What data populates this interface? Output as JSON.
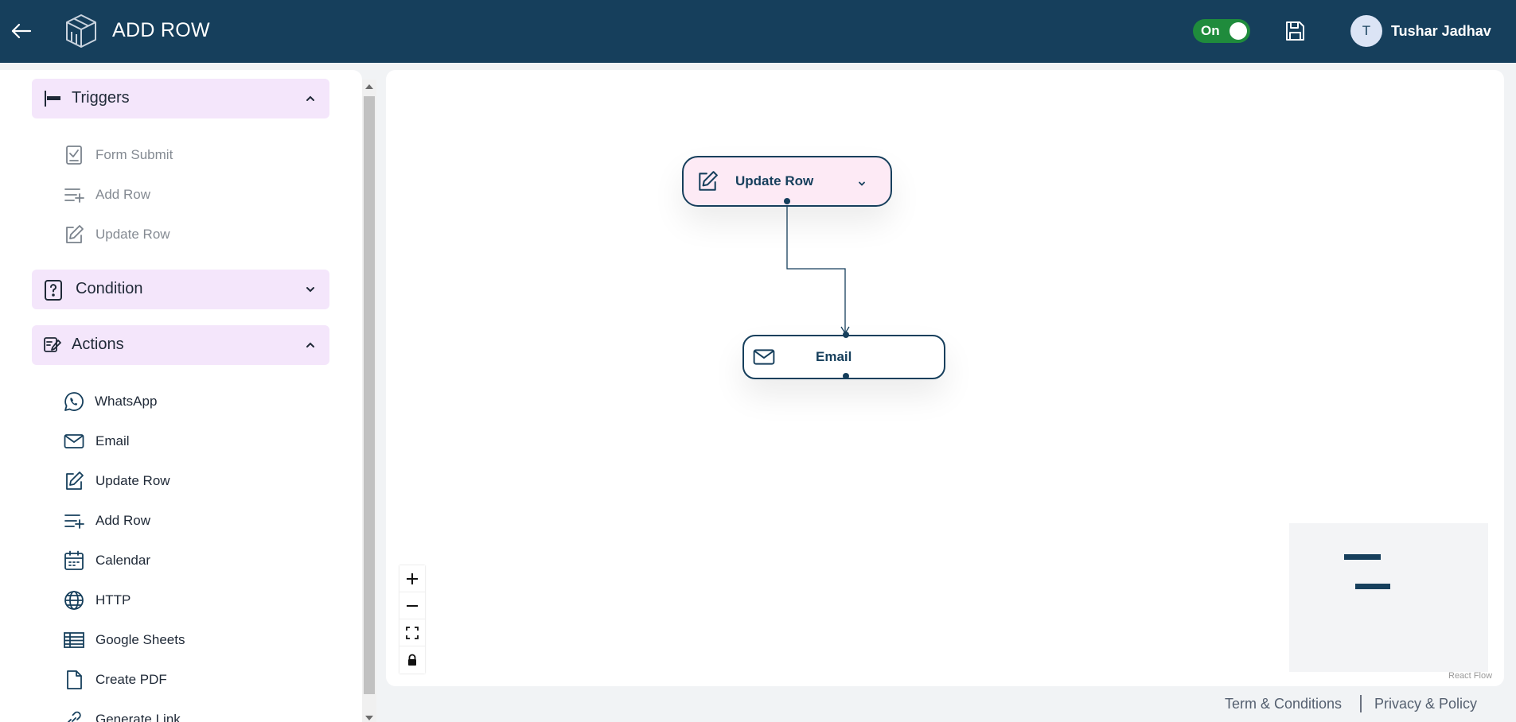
{
  "header": {
    "title": "ADD ROW",
    "toggle_label": "On",
    "user_initial": "T",
    "user_name": "Tushar Jadhav"
  },
  "sidebar": {
    "sections": [
      {
        "title": "Triggers",
        "expanded": true,
        "items": [
          {
            "label": "Form Submit",
            "icon": "form-check-icon"
          },
          {
            "label": "Add Row",
            "icon": "list-plus-icon"
          },
          {
            "label": "Update Row",
            "icon": "edit-icon"
          }
        ]
      },
      {
        "title": "Condition",
        "expanded": false,
        "items": []
      },
      {
        "title": "Actions",
        "expanded": true,
        "items": [
          {
            "label": "WhatsApp",
            "icon": "whatsapp-icon"
          },
          {
            "label": "Email",
            "icon": "mail-icon"
          },
          {
            "label": "Update Row",
            "icon": "edit-icon"
          },
          {
            "label": "Add Row",
            "icon": "list-plus-icon"
          },
          {
            "label": "Calendar",
            "icon": "calendar-icon"
          },
          {
            "label": "HTTP",
            "icon": "globe-icon"
          },
          {
            "label": "Google Sheets",
            "icon": "sheet-icon"
          },
          {
            "label": "Create PDF",
            "icon": "file-icon"
          },
          {
            "label": "Generate Link",
            "icon": "link-icon"
          }
        ]
      }
    ]
  },
  "flow": {
    "nodes": [
      {
        "label": "Update Row",
        "icon": "edit-icon"
      },
      {
        "label": "Email",
        "icon": "mail-icon"
      }
    ],
    "attribution": "React Flow"
  },
  "footer": {
    "terms": "Term & Conditions",
    "privacy": "Privacy & Policy"
  },
  "colors": {
    "primary": "#163f5c",
    "section_bg": "#f4e6fb",
    "toggle_on": "#1f8b3c",
    "node_highlight": "#fdeaf5"
  }
}
